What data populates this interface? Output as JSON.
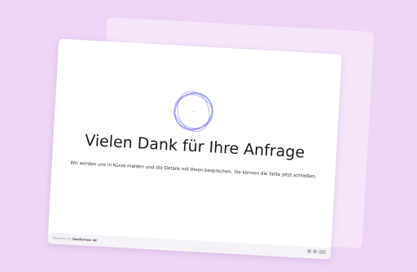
{
  "confirmation": {
    "title": "Vielen Dank für Ihre Anfrage",
    "message": "Wir werden uns in Kürze melden und die Details mit Ihnen besprechen. Sie können die Seite jetzt schließen."
  },
  "footer": {
    "powered_prefix": "Powered by",
    "brand": "bauformer AI",
    "icons": [
      "info-icon",
      "shield-icon",
      "language-icon"
    ]
  },
  "colors": {
    "background": "#ecd6f4",
    "back_card": "#f5e6fa",
    "logo_stroke": "#8b8ff0"
  }
}
